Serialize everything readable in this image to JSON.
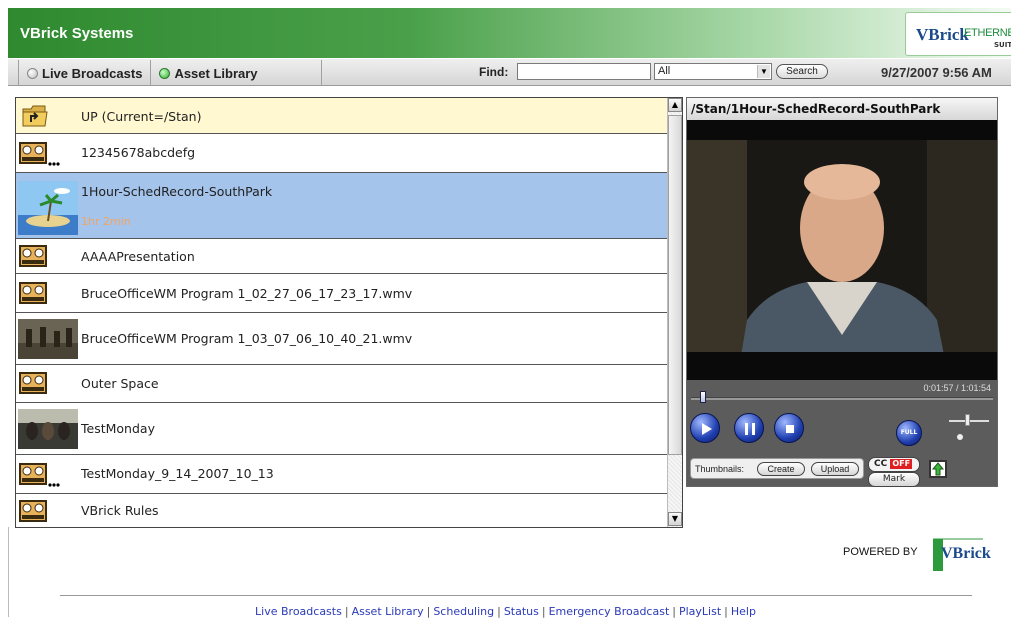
{
  "app": {
    "title": "VBrick Systems"
  },
  "logo": {
    "brand": "VBrick",
    "product": "ETHERNETV",
    "suite": "SUITE"
  },
  "nav": {
    "tabs": [
      {
        "label": "Live Broadcasts",
        "active": false
      },
      {
        "label": "Asset Library",
        "active": true
      }
    ],
    "find_label": "Find:",
    "find_value": "",
    "filter_selected": "All",
    "search_label": "Search",
    "datetime": "9/27/2007 9:56 AM"
  },
  "list": {
    "items": [
      {
        "name": "UP (Current=/Stan)",
        "icon": "folder-up-icon",
        "kind": "up"
      },
      {
        "name": "12345678abcdefg",
        "icon": "film-reel-dots-icon",
        "kind": "plain"
      },
      {
        "name": "1Hour-SchedRecord-SouthPark",
        "icon": "beach-thumbnail",
        "kind": "selected",
        "subtitle": "1hr 2min"
      },
      {
        "name": "AAAAPresentation",
        "icon": "film-reel-icon",
        "kind": "plain"
      },
      {
        "name": "BruceOfficeWM Program 1_02_27_06_17_23_17.wmv",
        "icon": "film-reel-icon",
        "kind": "plain"
      },
      {
        "name": "BruceOfficeWM Program 1_03_07_06_10_40_21.wmv",
        "icon": "video-thumbnail",
        "kind": "plain"
      },
      {
        "name": "Outer Space",
        "icon": "film-reel-icon",
        "kind": "plain"
      },
      {
        "name": "TestMonday",
        "icon": "video-thumbnail",
        "kind": "plain"
      },
      {
        "name": "TestMonday_9_14_2007_10_13",
        "icon": "film-reel-dots-icon",
        "kind": "plain"
      },
      {
        "name": "VBrick Rules",
        "icon": "film-reel-icon",
        "kind": "plain"
      }
    ]
  },
  "player": {
    "title": "/Stan/1Hour-SchedRecord-SouthPark",
    "time": "0:01:57 / 1:01:54",
    "progress": 0.03,
    "volume": 0.45,
    "full_label": "FULL",
    "thumbnails_label": "Thumbnails:",
    "create_label": "Create",
    "upload_label": "Upload",
    "cc_label": "CC",
    "cc_state": "OFF",
    "mark_label": "Mark"
  },
  "powered_by": "POWERED BY",
  "powered_brand": "VBrick",
  "footer": {
    "links": [
      "Live Broadcasts",
      "Asset Library",
      "Scheduling",
      "Status",
      "Emergency Broadcast",
      "PlayList",
      "Help"
    ]
  },
  "colors": {
    "header_green": "#2f8a2f",
    "selected_row": "#a4c4ec",
    "up_row": "#fff8d0",
    "footer_link": "#2a3ab8",
    "subtitle": "#f4a460"
  }
}
